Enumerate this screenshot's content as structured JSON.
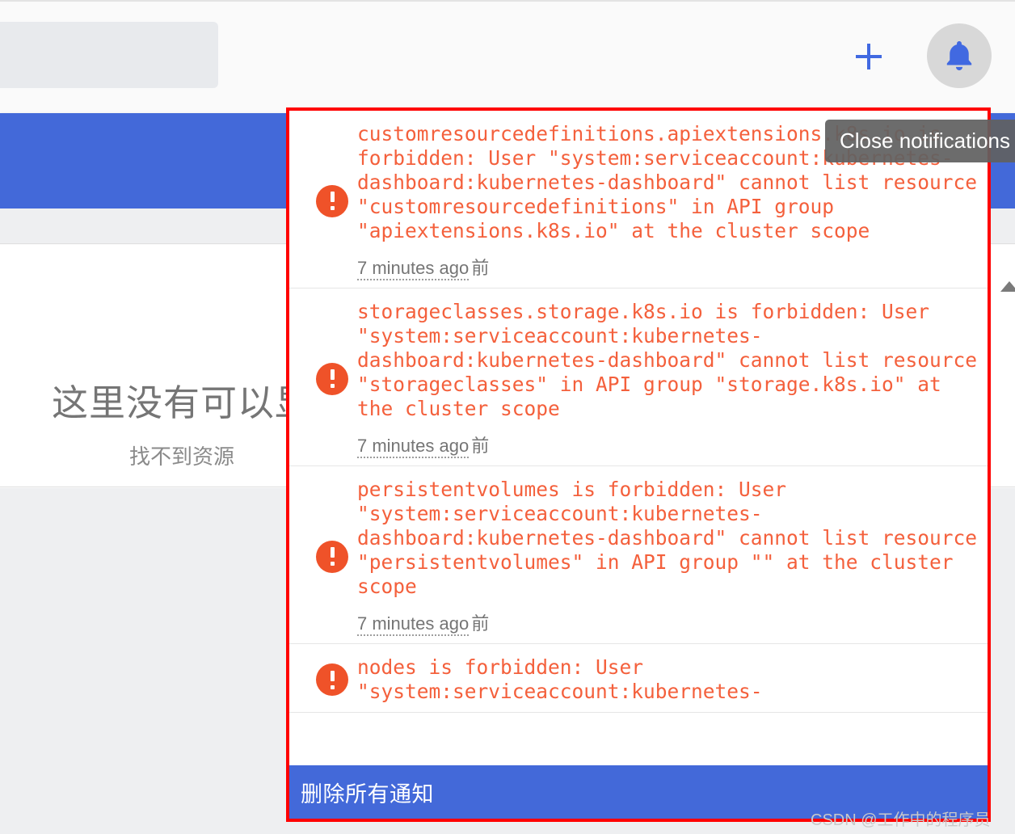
{
  "app": {
    "search": {
      "placeholder": ""
    },
    "icons": {
      "plus": "plus-icon",
      "bell": "bell-icon",
      "scroll_up": "scroll-up-arrow-icon"
    },
    "empty_state": {
      "title": "这里没有可以显",
      "subtitle": "找不到资源"
    }
  },
  "tooltip": {
    "text": "Close notifications"
  },
  "notifications": {
    "items": [
      {
        "severity": "error",
        "icon": "error-icon",
        "message": "customresourcedefinitions.apiextensions.k8s.io is forbidden: User \"system:serviceaccount:kubernetes-dashboard:kubernetes-dashboard\" cannot list resource \"customresourcedefinitions\" in API group \"apiextensions.k8s.io\" at the cluster scope",
        "time_relative": "7 minutes ago",
        "time_suffix": "前"
      },
      {
        "severity": "error",
        "icon": "error-icon",
        "message": "storageclasses.storage.k8s.io is forbidden: User \"system:serviceaccount:kubernetes-dashboard:kubernetes-dashboard\" cannot list resource \"storageclasses\" in API group \"storage.k8s.io\" at the cluster scope",
        "time_relative": "7 minutes ago",
        "time_suffix": "前"
      },
      {
        "severity": "error",
        "icon": "error-icon",
        "message": "persistentvolumes is forbidden: User \"system:serviceaccount:kubernetes-dashboard:kubernetes-dashboard\" cannot list resource \"persistentvolumes\" in API group \"\" at the cluster scope",
        "time_relative": "7 minutes ago",
        "time_suffix": "前"
      },
      {
        "severity": "error",
        "icon": "error-icon",
        "message": "nodes is forbidden: User \"system:serviceaccount:kubernetes-",
        "time_relative": "",
        "time_suffix": ""
      }
    ],
    "footer_label": "删除所有通知"
  },
  "watermark": {
    "text": "CSDN @工作中的程序员"
  },
  "colors": {
    "brand_blue": "#4369d9",
    "error_orange": "#ef5229",
    "error_text": "#f4603c",
    "highlight_border": "#ff0000",
    "tooltip_bg": "#616161"
  }
}
